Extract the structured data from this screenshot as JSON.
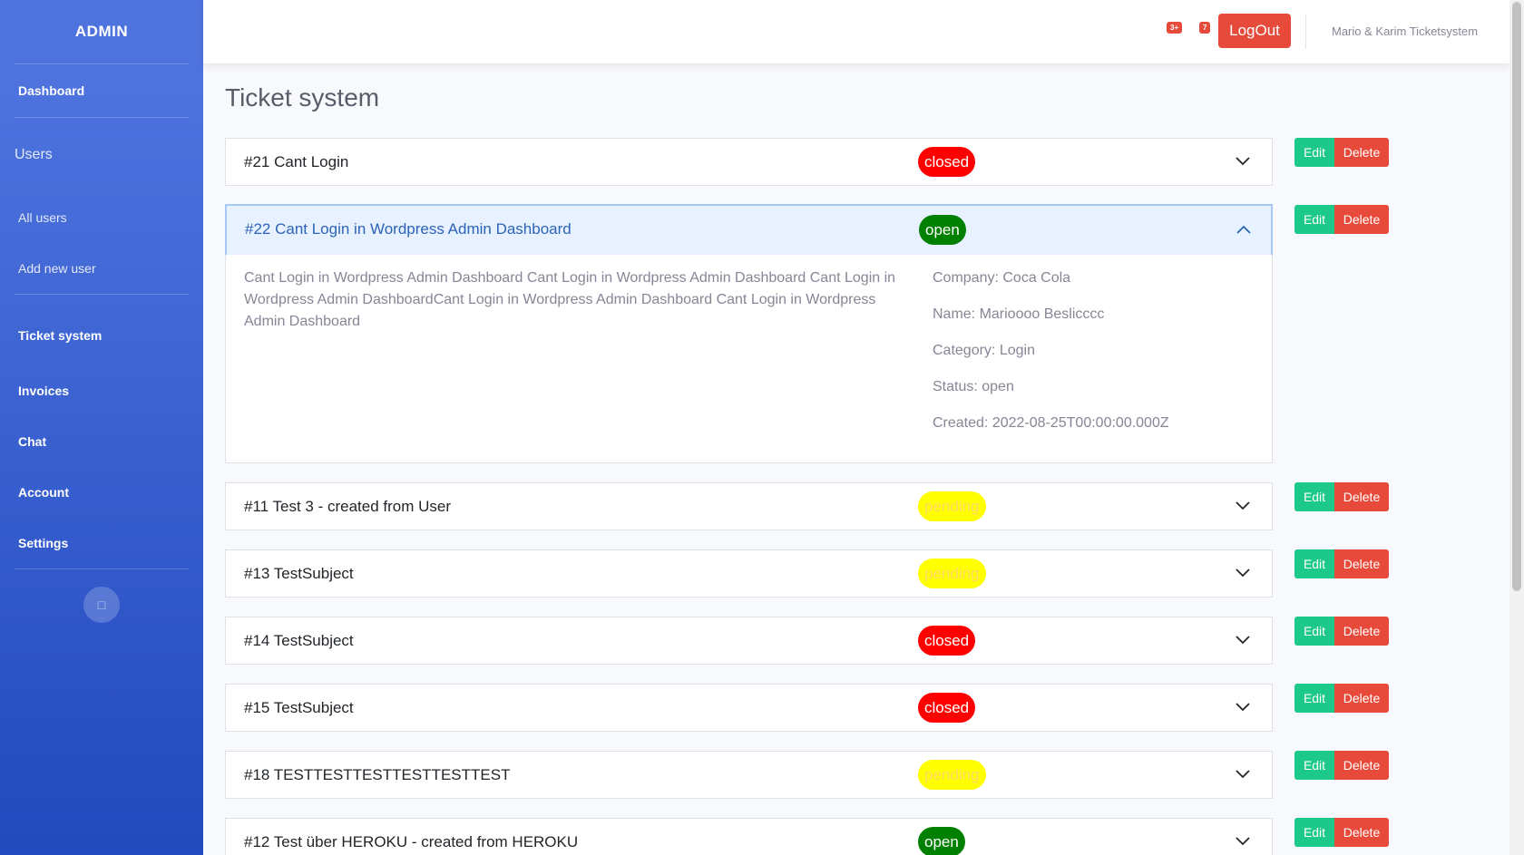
{
  "sidebar": {
    "brand": "ADMIN",
    "dashboard": "Dashboard",
    "users_heading": "Users",
    "all_users": "All users",
    "add_new_user": "Add new user",
    "ticket_system": "Ticket system",
    "invoices": "Invoices",
    "chat": "Chat",
    "account": "Account",
    "settings": "Settings",
    "toggle_icon": "chevron-left-icon"
  },
  "topbar": {
    "alerts_badge": "3+",
    "messages_badge": "7",
    "logout_label": "LogOut",
    "brand_text": "Mario & Karim Ticketsystem"
  },
  "page": {
    "title": "Ticket system"
  },
  "actions": {
    "edit_label": "Edit",
    "delete_label": "Delete"
  },
  "tickets": [
    {
      "subject": "#21 Cant Login",
      "status": "closed"
    },
    {
      "subject": "#22 Cant Login in Wordpress Admin Dashboard",
      "status": "open",
      "expanded": true
    },
    {
      "subject": "#11 Test 3 - created from User",
      "status": "pending"
    },
    {
      "subject": "#13 TestSubject",
      "status": "pending"
    },
    {
      "subject": "#14 TestSubject",
      "status": "closed"
    },
    {
      "subject": "#15 TestSubject",
      "status": "closed"
    },
    {
      "subject": "#18 TESTTESTTESTTESTTESTTEST",
      "status": "pending"
    },
    {
      "subject": "#12 Test über HEROKU - created from HEROKU",
      "status": "open"
    }
  ],
  "expanded_detail": {
    "description": "Cant Login in Wordpress Admin Dashboard Cant Login in Wordpress Admin Dashboard Cant Login in Wordpress Admin DashboardCant Login in Wordpress Admin Dashboard Cant Login in Wordpress Admin Dashboard",
    "company": "Company: Coca Cola",
    "name": "Name: Marioooo Beslicccc",
    "category": "Category: Login",
    "status": "Status: open",
    "created": "Created: 2022-08-25T00:00:00.000Z"
  },
  "colors": {
    "sidebar_start": "#4e73df",
    "sidebar_end": "#224abe",
    "closed": "#ff0000",
    "open": "#008000",
    "pending": "#ffff00",
    "edit": "#1cc88a",
    "delete": "#e74a3b"
  }
}
